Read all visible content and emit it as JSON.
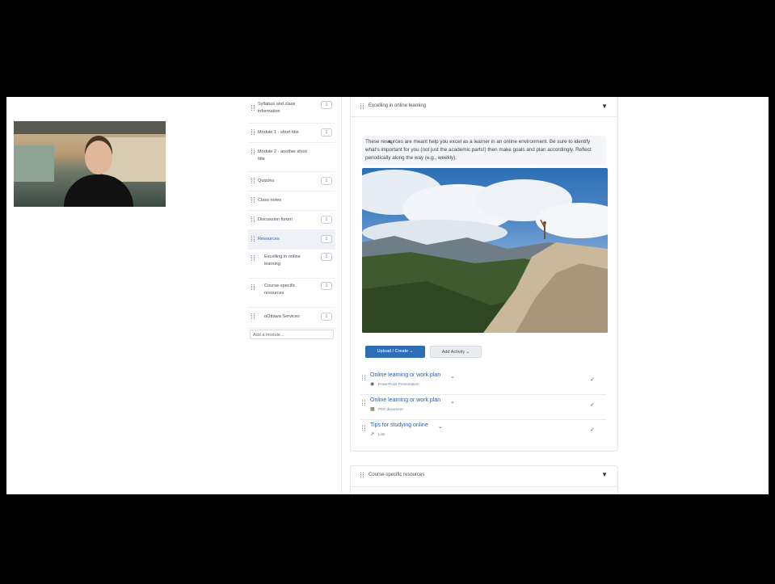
{
  "sidebar": {
    "items": [
      {
        "label": "Syllabus and class information",
        "count": "1"
      },
      {
        "label": "Module 1 - short title",
        "count": "1"
      },
      {
        "label": "Module 2 - another short title",
        "count": "1"
      },
      {
        "label": "Quizzes",
        "count": "1"
      },
      {
        "label": "Class notes",
        "count": ""
      },
      {
        "label": "Discussion forum",
        "count": "1"
      },
      {
        "label": "Resources",
        "count": "1"
      },
      {
        "label": "Excelling in online learning",
        "count": "1"
      },
      {
        "label": "Course-specific resources",
        "count": "1"
      },
      {
        "label": "uOttawa Services",
        "count": "1"
      }
    ],
    "add_module_placeholder": "Add a module..."
  },
  "section": {
    "title": "Excelling in online learning",
    "description": "These resources are meant help you excel as a learner in an online environment. Be sure to identify what's important for you (not just the academic parts!) then make goals and plan accordingly. Reflect periodically along the way (e.g., weekly).",
    "upload_create_label": "Upload / Create",
    "add_activity_label": "Add Activity"
  },
  "activities": [
    {
      "title": "Online learning or work plan",
      "type": "PowerPoint Presentation",
      "icon": "powerpoint-icon"
    },
    {
      "title": "Online learning or work plan",
      "type": "PDF document",
      "icon": "pdf-icon"
    },
    {
      "title": "Tips for studying online",
      "type": "Link",
      "icon": "link-icon"
    }
  ],
  "next_section": {
    "title": "Course-specific resources"
  }
}
